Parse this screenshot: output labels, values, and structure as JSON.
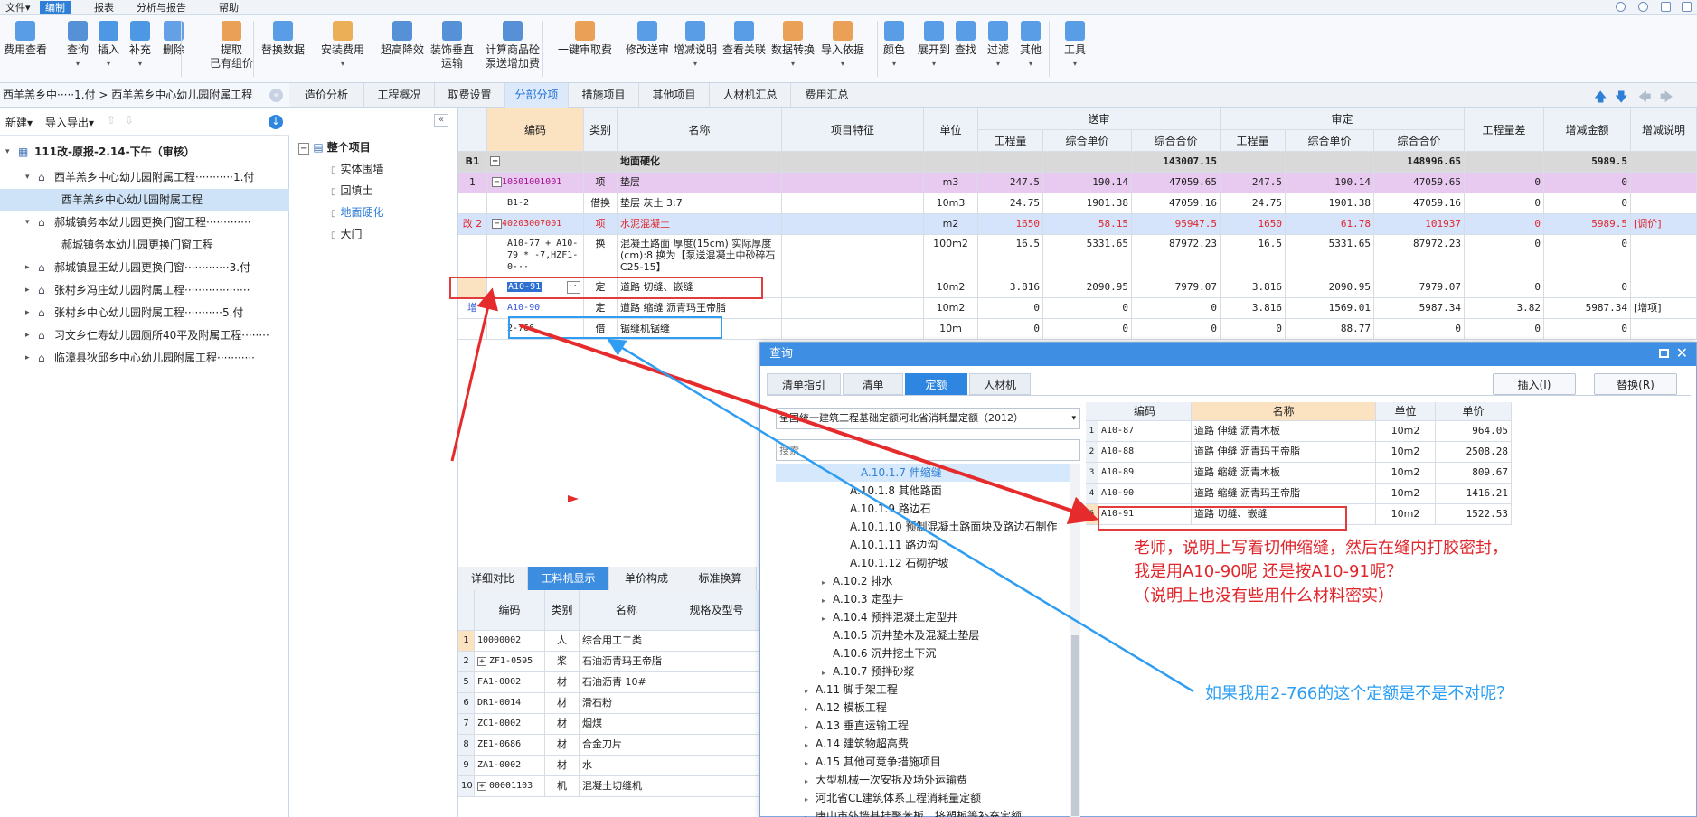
{
  "menu": {
    "items": [
      "文件▾",
      "编制",
      "报表",
      "分析与报告",
      "帮助"
    ],
    "active_index": 1
  },
  "toolbar": {
    "buttons": [
      {
        "label": "费用查看",
        "icon": "cost-view-icon"
      },
      {
        "label": "查询",
        "icon": "query-icon",
        "dropdown": true
      },
      {
        "label": "插入",
        "icon": "insert-icon",
        "dropdown": true
      },
      {
        "label": "补充",
        "icon": "supplement-icon",
        "dropdown": true
      },
      {
        "label": "删除",
        "icon": "delete-icon"
      },
      {
        "label": "提取",
        "sub": "已有组价",
        "icon": "extract-icon"
      },
      {
        "label": "替换数据",
        "icon": "replace-data-icon"
      },
      {
        "label": "安装费用",
        "icon": "install-cost-icon",
        "dropdown": true
      },
      {
        "label": "超高降效",
        "icon": "height-reduction-icon"
      },
      {
        "label": "装饰垂直",
        "sub": "运输",
        "icon": "vertical-transport-icon",
        "dropdown": true
      },
      {
        "label": "计算商品砼",
        "sub": "泵送增加费",
        "icon": "concrete-pump-icon"
      },
      {
        "label": "一键审取费",
        "icon": "one-click-audit-icon"
      },
      {
        "label": "修改送审",
        "icon": "edit-submit-icon"
      },
      {
        "label": "增减说明",
        "icon": "change-note-icon",
        "dropdown": true
      },
      {
        "label": "查看关联",
        "icon": "view-link-icon"
      },
      {
        "label": "数据转换",
        "icon": "data-convert-icon",
        "dropdown": true
      },
      {
        "label": "导入依据",
        "icon": "import-basis-icon",
        "dropdown": true
      },
      {
        "label": "颜色",
        "icon": "color-icon",
        "dropdown": true
      },
      {
        "label": "展开到",
        "icon": "expand-to-icon",
        "dropdown": true
      },
      {
        "label": "查找",
        "icon": "find-icon"
      },
      {
        "label": "过滤",
        "icon": "filter-icon",
        "dropdown": true
      },
      {
        "label": "其他",
        "icon": "other-icon",
        "dropdown": true
      },
      {
        "label": "工具",
        "icon": "tools-icon",
        "dropdown": true
      }
    ]
  },
  "breadcrumb": "西羊羔乡中·····1.付 > 西羊羔乡中心幼儿园附属工程",
  "main_tabs": [
    "造价分析",
    "工程概况",
    "取费设置",
    "分部分项",
    "措施项目",
    "其他项目",
    "人材机汇总",
    "费用汇总"
  ],
  "main_tab_active": 3,
  "left_toolbar": {
    "new": "新建▾",
    "import_export": "导入导出▾"
  },
  "project_tree": [
    {
      "label": "111改-原报-2.14-下午（审核）",
      "level": 0,
      "bold": true
    },
    {
      "label": "西羊羔乡中心幼儿园附属工程···········1.付",
      "level": 1,
      "expanded": true
    },
    {
      "label": "西羊羔乡中心幼儿园附属工程",
      "level": 2,
      "selected": true
    },
    {
      "label": "郝城镇务本幼儿园更换门窗工程·············",
      "level": 1,
      "expanded": true
    },
    {
      "label": "郝城镇务本幼儿园更换门窗工程",
      "level": 2
    },
    {
      "label": "郝城镇显王幼儿园更换门窗·············3.付",
      "level": 1
    },
    {
      "label": "张村乡冯庄幼儿园附属工程···················",
      "level": 1
    },
    {
      "label": "张村乡中心幼儿园附属工程···········5.付",
      "level": 1
    },
    {
      "label": "习文乡仁寿幼儿园厕所40平及附属工程········",
      "level": 1
    },
    {
      "label": "临漳县狄邱乡中心幼儿园附属工程···········",
      "level": 1
    }
  ],
  "section_tree": {
    "root": "整个项目",
    "items": [
      "实体围墙",
      "回填土",
      "地面硬化",
      "大门"
    ],
    "selected_index": 2
  },
  "grid": {
    "headers": {
      "code": "编码",
      "type": "类别",
      "name": "名称",
      "feature": "项目特征",
      "unit": "单位",
      "submit": "送审",
      "audit": "审定",
      "qty": "工程量",
      "unit_price": "综合单价",
      "total": "综合合价",
      "qty_diff": "工程量差",
      "amount_diff": "增减金额",
      "note": "增减说明"
    },
    "rows": [
      {
        "idx": "B1",
        "code": "",
        "type": "",
        "name": "地面硬化",
        "feature": "",
        "unit": "",
        "sq": "",
        "sp": "",
        "st": "143007.15",
        "aq": "",
        "ap": "",
        "at": "148996.65",
        "dq": "",
        "da": "5989.5",
        "note": "",
        "kind": "section"
      },
      {
        "idx": "1",
        "code": "010501001001",
        "type": "项",
        "name": "垫层",
        "feature": "",
        "unit": "m3",
        "sq": "247.5",
        "sp": "190.14",
        "st": "47059.65",
        "aq": "247.5",
        "ap": "190.14",
        "at": "47059.65",
        "dq": "0",
        "da": "0",
        "note": "",
        "kind": "item"
      },
      {
        "idx": "",
        "code": "B1-2",
        "type": "借换",
        "name": "垫层 灰土 3:7",
        "feature": "",
        "unit": "10m3",
        "sq": "24.75",
        "sp": "1901.38",
        "st": "47059.16",
        "aq": "24.75",
        "ap": "1901.38",
        "at": "47059.16",
        "dq": "0",
        "da": "0",
        "note": "",
        "kind": "sub"
      },
      {
        "idx": "改 2",
        "code": "040203007001",
        "type": "项",
        "name": "水泥混凝土",
        "feature": "",
        "unit": "m2",
        "sq": "1650",
        "sp": "58.15",
        "st": "95947.5",
        "aq": "1650",
        "ap": "61.78",
        "at": "101937",
        "dq": "0",
        "da": "5989.5",
        "note": "[调价]",
        "kind": "item-changed"
      },
      {
        "idx": "",
        "code": "A10-77 + A10-79 * -7,HZF1-0···",
        "type": "换",
        "name": "混凝土路面 厚度(15cm)  实际厚度(cm):8  换为【泵送混凝土中砂碎石 C25-15】",
        "feature": "",
        "unit": "100m2",
        "sq": "16.5",
        "sp": "5331.65",
        "st": "87972.23",
        "aq": "16.5",
        "ap": "5331.65",
        "at": "87972.23",
        "dq": "0",
        "da": "0",
        "note": "",
        "kind": "sub-tall"
      },
      {
        "idx": "",
        "code": "A10-91",
        "type": "定",
        "name": "道路 切缝、嵌缝",
        "feature": "",
        "unit": "10m2",
        "sq": "3.816",
        "sp": "2090.95",
        "st": "7979.07",
        "aq": "3.816",
        "ap": "2090.95",
        "at": "7979.07",
        "dq": "0",
        "da": "0",
        "note": "",
        "kind": "sub-selected"
      },
      {
        "idx": "增",
        "code": "A10-90",
        "type": "定",
        "name": "道路 缩缝 沥青玛王帝脂",
        "feature": "",
        "unit": "10m2",
        "sq": "0",
        "sp": "0",
        "st": "0",
        "aq": "3.816",
        "ap": "1569.01",
        "at": "5987.34",
        "dq": "3.82",
        "da": "5987.34",
        "note": "[增项]",
        "kind": "sub-added"
      },
      {
        "idx": "",
        "code": "2-766",
        "type": "借",
        "name": "锯缝机锯缝",
        "feature": "",
        "unit": "10m",
        "sq": "0",
        "sp": "0",
        "st": "0",
        "aq": "0",
        "ap": "88.77",
        "at": "0",
        "dq": "0",
        "da": "0",
        "note": "",
        "kind": "sub"
      }
    ]
  },
  "bottom_tabs": [
    "详细对比",
    "工料机显示",
    "单价构成",
    "标准换算"
  ],
  "bottom_tab_active": 1,
  "resource_grid": {
    "headers": {
      "code": "编码",
      "type": "类别",
      "name": "名称",
      "spec": "规格及型号"
    },
    "rows": [
      {
        "idx": "1",
        "code": "10000002",
        "type": "人",
        "name": "综合用工二类",
        "plus": false
      },
      {
        "idx": "2",
        "code": "ZF1-0595",
        "type": "浆",
        "name": "石油沥青玛王帝脂",
        "plus": true
      },
      {
        "idx": "5",
        "code": "FA1-0002",
        "type": "材",
        "name": "石油沥青 10#",
        "plus": false
      },
      {
        "idx": "6",
        "code": "DR1-0014",
        "type": "材",
        "name": "滑石粉",
        "plus": false
      },
      {
        "idx": "7",
        "code": "ZC1-0002",
        "type": "材",
        "name": "烟煤",
        "plus": false
      },
      {
        "idx": "8",
        "code": "ZE1-0686",
        "type": "材",
        "name": "合金刀片",
        "plus": false
      },
      {
        "idx": "9",
        "code": "ZA1-0002",
        "type": "材",
        "name": "水",
        "plus": false
      },
      {
        "idx": "10",
        "code": "00001103",
        "type": "机",
        "name": "混凝土切缝机",
        "plus": true
      }
    ]
  },
  "query_dialog": {
    "title": "查询",
    "tabs": [
      "清单指引",
      "清单",
      "定额",
      "人材机"
    ],
    "active_tab": 2,
    "insert_button": "插入(I)",
    "replace_button": "替换(R)",
    "quota_select": "全国统一建筑工程基础定额河北省消耗量定额（2012）",
    "search_placeholder": "搜索",
    "tree": [
      {
        "label": "A.10.1.7 伸缩缝",
        "level": 3,
        "selected": true
      },
      {
        "label": "A.10.1.8 其他路面",
        "level": 3
      },
      {
        "label": "A.10.1.9 路边石",
        "level": 3
      },
      {
        "label": "A.10.1.10 预制混凝土路面块及路边石制作",
        "level": 3
      },
      {
        "label": "A.10.1.11 路边沟",
        "level": 3
      },
      {
        "label": "A.10.1.12 石砌护坡",
        "level": 3
      },
      {
        "label": "A.10.2 排水",
        "level": 2,
        "arrow": true
      },
      {
        "label": "A.10.3 定型井",
        "level": 2,
        "arrow": true
      },
      {
        "label": "A.10.4 预拌混凝土定型井",
        "level": 2,
        "arrow": true
      },
      {
        "label": "A.10.5 沉井垫木及混凝土垫层",
        "level": 2
      },
      {
        "label": "A.10.6 沉井挖土下沉",
        "level": 2
      },
      {
        "label": "A.10.7 预拌砂浆",
        "level": 2,
        "arrow": true
      },
      {
        "label": "A.11 脚手架工程",
        "level": 1,
        "arrow": true
      },
      {
        "label": "A.12 模板工程",
        "level": 1,
        "arrow": true
      },
      {
        "label": "A.13 垂直运输工程",
        "level": 1,
        "arrow": true
      },
      {
        "label": "A.14 建筑物超高费",
        "level": 1,
        "arrow": true
      },
      {
        "label": "A.15 其他可竞争措施项目",
        "level": 1,
        "arrow": true
      },
      {
        "label": "大型机械一次安拆及场外运输费",
        "level": 1,
        "arrow": true
      },
      {
        "label": "河北省CL建筑体系工程消耗量定额",
        "level": 1,
        "arrow": true
      },
      {
        "label": "唐山市外墙基挂聚苯板、挤塑板等补充定额",
        "level": 1,
        "arrow": true
      }
    ],
    "result_headers": {
      "code": "编码",
      "name": "名称",
      "unit": "单位",
      "price": "单价"
    },
    "results": [
      {
        "idx": "1",
        "code": "A10-87",
        "name": "道路 伸缝 沥青木板",
        "unit": "10m2",
        "price": "964.05"
      },
      {
        "idx": "2",
        "code": "A10-88",
        "name": "道路 伸缝 沥青玛王帝脂",
        "unit": "10m2",
        "price": "2508.28"
      },
      {
        "idx": "3",
        "code": "A10-89",
        "name": "道路 缩缝 沥青木板",
        "unit": "10m2",
        "price": "809.67"
      },
      {
        "idx": "4",
        "code": "A10-90",
        "name": "道路 缩缝 沥青玛王帝脂",
        "unit": "10m2",
        "price": "1416.21"
      },
      {
        "idx": "5",
        "code": "A10-91",
        "name": "道路 切缝、嵌缝",
        "unit": "10m2",
        "price": "1522.53"
      }
    ]
  },
  "annotations": {
    "red_lines": [
      "老师，说明上写着切伸缩缝，然后在缝内打胶密封，",
      "我是用A10-90呢    还是按A10-91呢？",
      "（说明上也没有些用什么材料密实）"
    ],
    "blue_line": "如果我用2-766的这个定额是不是不对呢？",
    "red_color": "#e0262b",
    "blue_color": "#2a9df4"
  },
  "colors": {
    "accent": "#2f7fd6",
    "section_row": "#d9d9d9",
    "item_row": "#e8c9f0",
    "changed_row": "#d6e4fb",
    "red_text": "#e0262b"
  }
}
